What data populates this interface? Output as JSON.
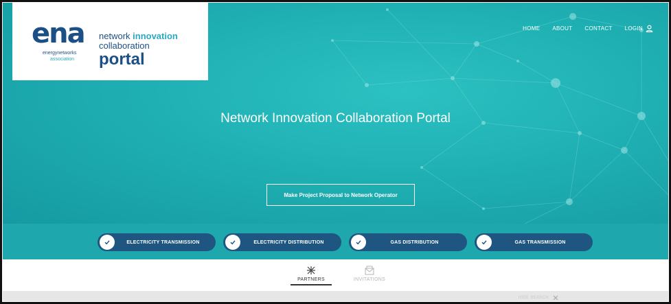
{
  "logo": {
    "ena_word": "ena",
    "ena_line1": "energynetworks",
    "ena_line2": "association",
    "portal_line1_a": "network ",
    "portal_line1_b": "innovation",
    "portal_line2": "collaboration",
    "portal_line3": "portal"
  },
  "nav": {
    "items": [
      {
        "label": "HOME"
      },
      {
        "label": "ABOUT"
      },
      {
        "label": "CONTACT"
      },
      {
        "label": "LOGIN",
        "icon": "user-icon"
      }
    ]
  },
  "hero": {
    "title": "Network Innovation Collaboration Portal",
    "cta_label": "Make Project Proposal to Network Operator"
  },
  "filters": {
    "items": [
      {
        "label": "ELECTRICITY TRANSMISSION",
        "checked": true
      },
      {
        "label": "ELECTRICITY DISTRIBUTION",
        "checked": true
      },
      {
        "label": "GAS DISTRIBUTION",
        "checked": true
      },
      {
        "label": "GAS TRANSMISSION",
        "checked": true
      }
    ]
  },
  "tabs": [
    {
      "label": "PARTNERS",
      "icon": "partners-icon",
      "active": true
    },
    {
      "label": "INVITATIONS",
      "icon": "envelope-icon",
      "active": false
    }
  ],
  "search": {
    "hide_label": "HIDE SEARCH",
    "icon": "close-icon"
  },
  "colors": {
    "hero_teal": "#1fb0b3",
    "filter_bar": "#1ea8ad",
    "pill_navy": "#1e5581",
    "brand_navy": "#1c4f86",
    "brand_cyan": "#29a8c2"
  }
}
